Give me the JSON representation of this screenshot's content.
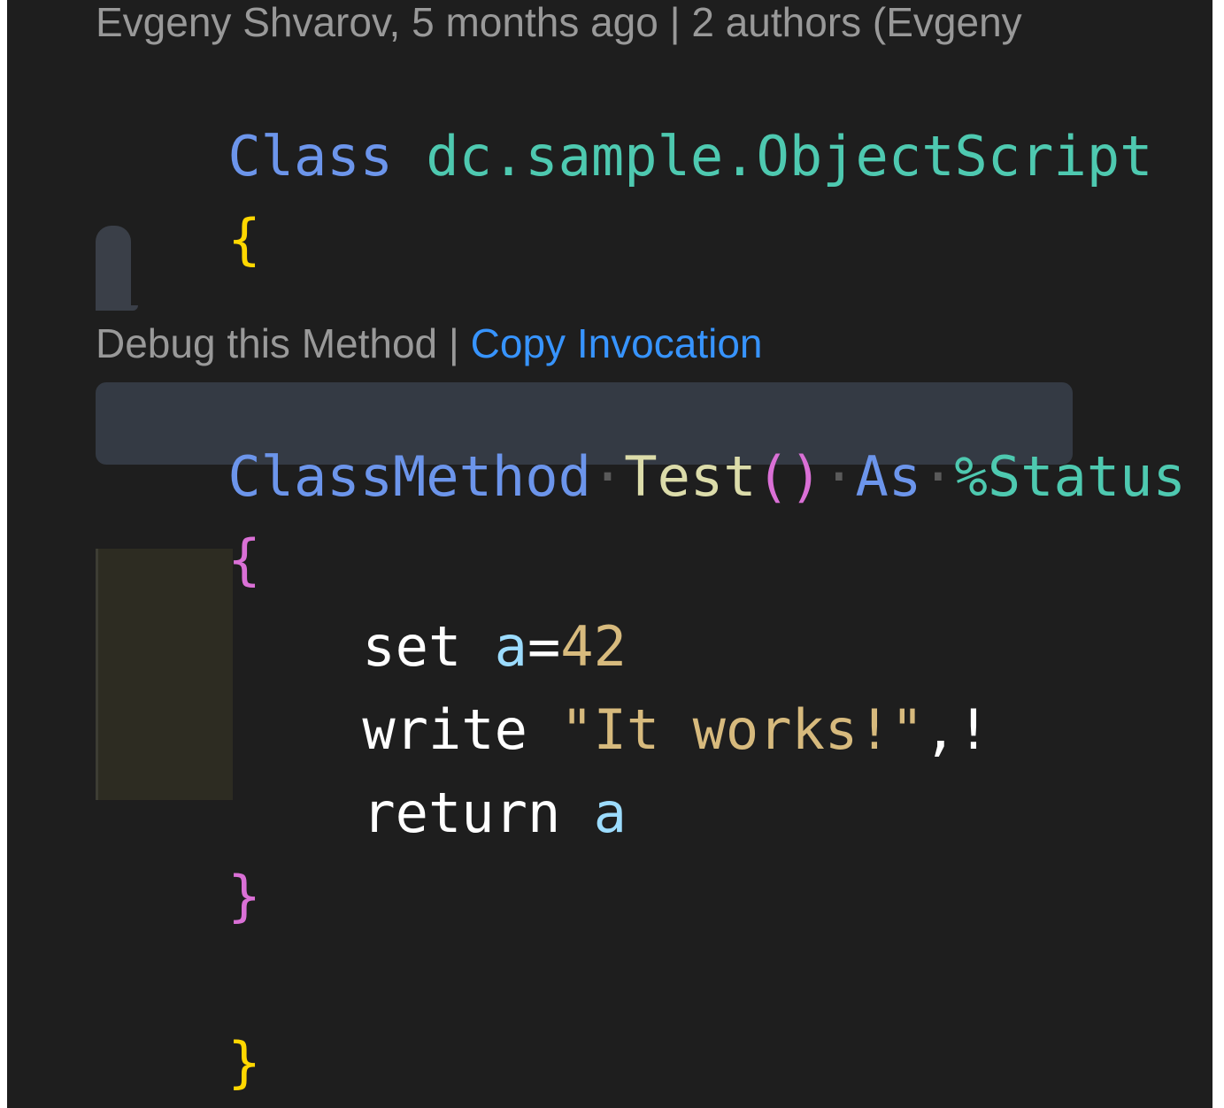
{
  "codelens": {
    "blame": "Evgeny Shvarov, 5 months ago | 2 authors (Evgeny",
    "debug": "Debug this Method",
    "separator": " | ",
    "copy": "Copy Invocation"
  },
  "code": {
    "line1": {
      "keyword": "Class",
      "name": "dc.sample.ObjectScript"
    },
    "line2": {
      "brace": "{"
    },
    "line4": {
      "keyword": "ClassMethod",
      "dot": "·",
      "method": "Test",
      "parens": "()",
      "as": "As",
      "type": "%Status"
    },
    "line5": {
      "brace": "{"
    },
    "line6": {
      "cmd": "set",
      "var": "a",
      "op": "=",
      "num": "42"
    },
    "line7": {
      "cmd": "write",
      "str": "\"It works!\"",
      "rest": ",!"
    },
    "line8": {
      "cmd": "return",
      "var": "a"
    },
    "line9": {
      "brace": "}"
    },
    "line11": {
      "brace": "}"
    }
  },
  "colors": {
    "background": "#1e1e1e",
    "keyword": "#6c95eb",
    "class_name": "#4ec9b0",
    "brace_level1": "#ffd700",
    "brace_level2": "#da70d6",
    "method_name": "#dcdcaa",
    "variable": "#9cdcfe",
    "literal": "#d7ba7d",
    "link": "#3794ff",
    "codelens_text": "#999999",
    "line_highlight": "#343a44"
  }
}
